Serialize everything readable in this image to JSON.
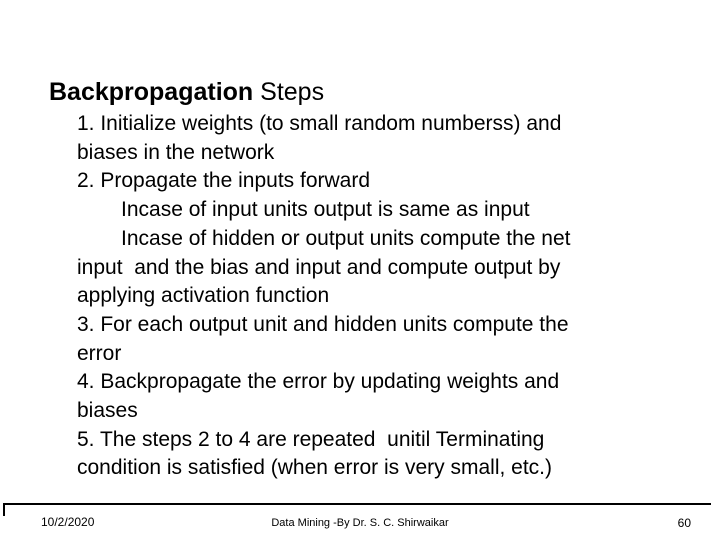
{
  "slide": {
    "title": {
      "strong": "Backpropagation",
      "rest": " Steps"
    },
    "body_lines": [
      {
        "text": "1. Initialize weights (to small random numberss) and",
        "indent": false
      },
      {
        "text": "biases in the network",
        "indent": false
      },
      {
        "text": "2. Propagate the inputs forward",
        "indent": false
      },
      {
        "text": "Incase of input units output is same as input",
        "indent": true
      },
      {
        "text": "Incase of hidden or output units compute the net",
        "indent": true
      },
      {
        "text": "input  and the bias and input and compute output by",
        "indent": false
      },
      {
        "text": "applying activation function",
        "indent": false
      },
      {
        "text": "3. For each output unit and hidden units compute the",
        "indent": false
      },
      {
        "text": "error",
        "indent": false
      },
      {
        "text": "4. Backpropagate the error by updating weights and",
        "indent": false
      },
      {
        "text": "biases",
        "indent": false
      },
      {
        "text": "5. The steps 2 to 4 are repeated  unitil Terminating",
        "indent": false
      },
      {
        "text": "condition is satisfied (when error is very small, etc.)",
        "indent": false
      }
    ],
    "footer": {
      "date": "10/2/2020",
      "center": "Data Mining -By Dr. S. C. Shirwaikar",
      "page_number": "60"
    },
    "colors": {
      "background": "#ffffff",
      "text": "#000000",
      "rule": "#000000"
    }
  }
}
